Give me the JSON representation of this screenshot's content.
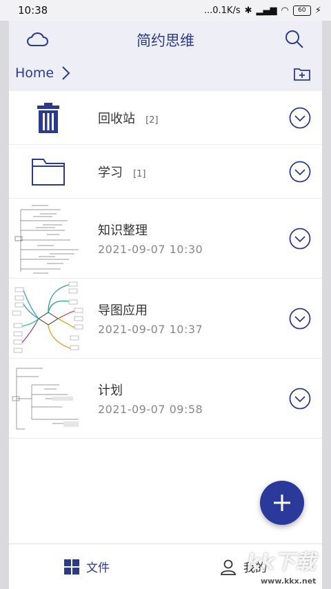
{
  "status": {
    "time": "10:38",
    "network": "...0.1K/s",
    "battery": "60"
  },
  "header": {
    "title": "简约思维"
  },
  "breadcrumb": {
    "home": "Home"
  },
  "folders": [
    {
      "name": "回收站",
      "count": "[2]"
    },
    {
      "name": "学习",
      "count": "[1]"
    }
  ],
  "files": [
    {
      "name": "知识整理",
      "date": "2021-09-07 10:30"
    },
    {
      "name": "导图应用",
      "date": "2021-09-07 10:37"
    },
    {
      "name": "计划",
      "date": "2021-09-07 09:58"
    }
  ],
  "tabs": {
    "files": "文件",
    "mine": "我的"
  },
  "watermark": {
    "text": "kk下载",
    "url": "www.kkx.net"
  },
  "colors": {
    "accent": "#2b3a8c",
    "fab": "#2b3a9a",
    "header_bg": "#eeeff6"
  }
}
